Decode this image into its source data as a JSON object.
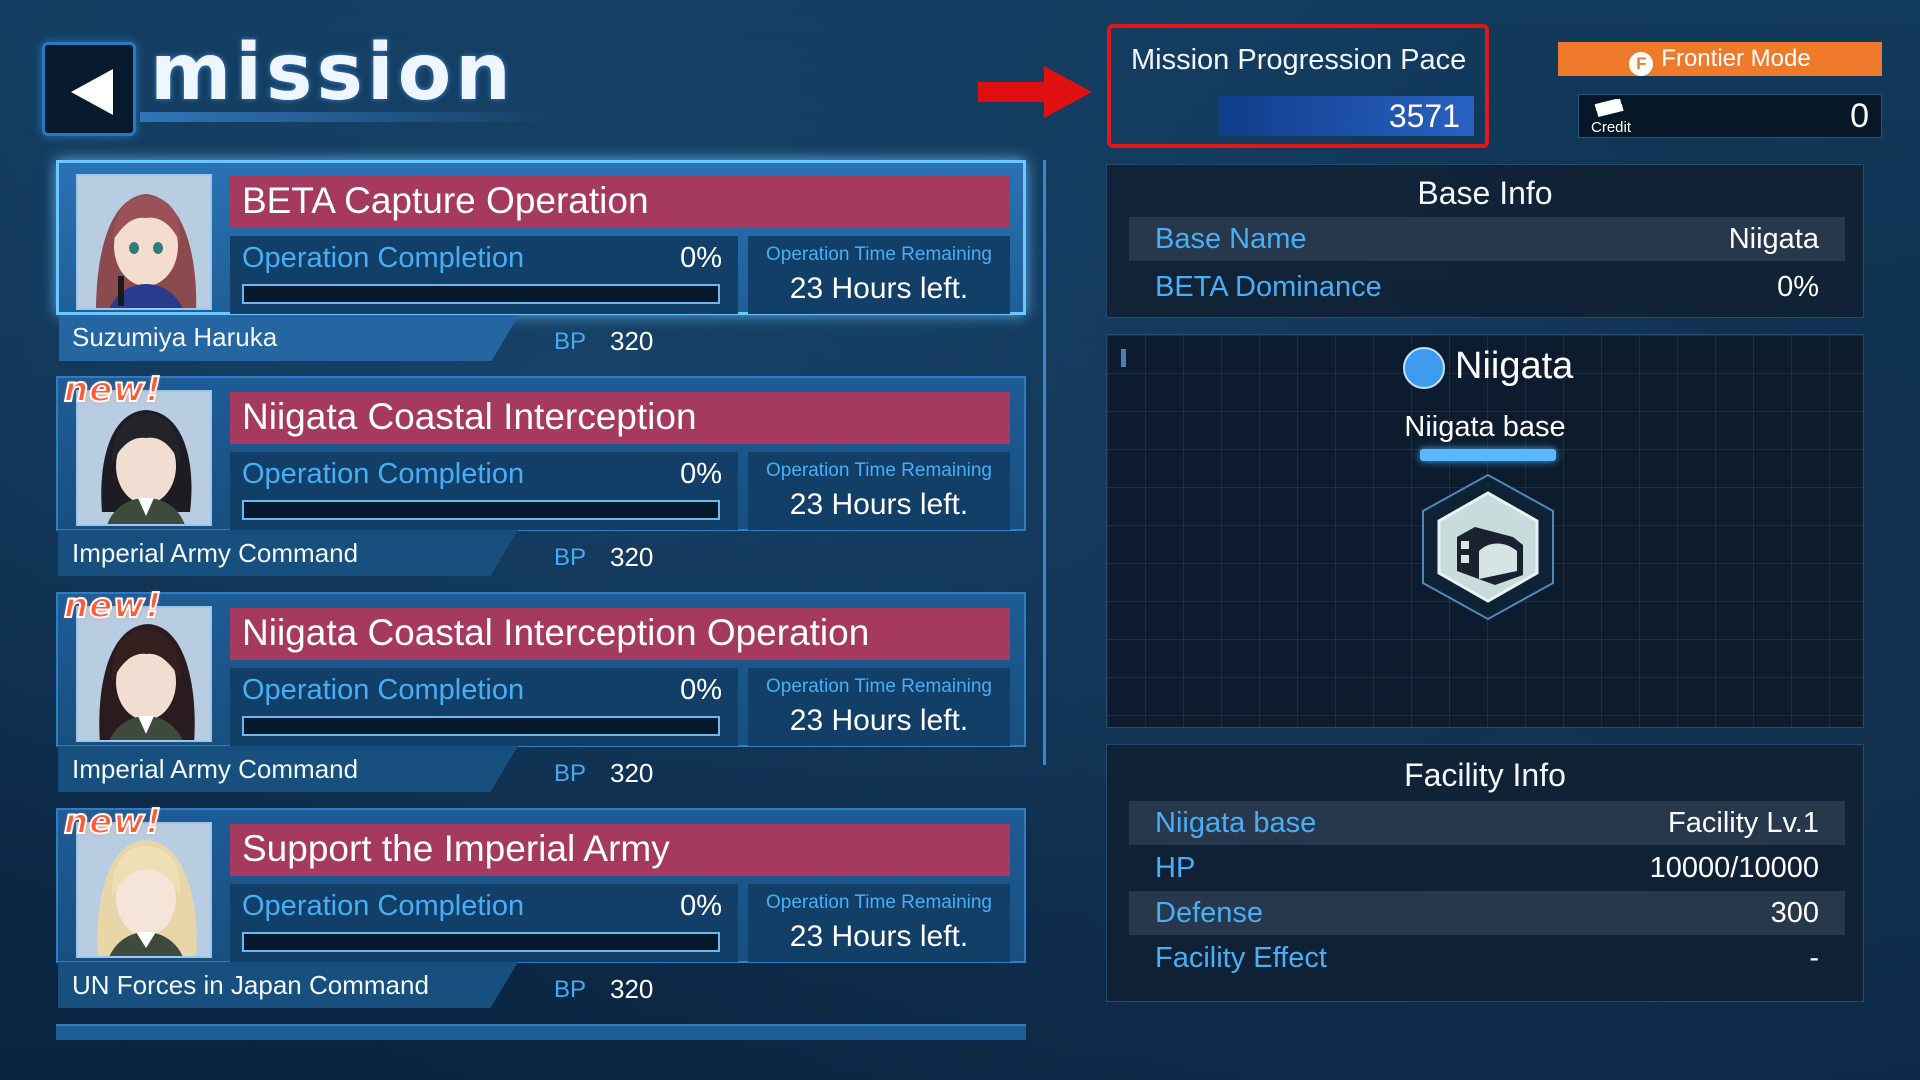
{
  "header": {
    "title": "MISSION",
    "back_label": "Back"
  },
  "pace": {
    "label": "Mission Progression Pace",
    "value": "3571"
  },
  "frontier": {
    "label": "Frontier Mode",
    "icon_glyph": "F"
  },
  "credit": {
    "label": "Credit",
    "value": "0"
  },
  "missions": [
    {
      "title": "BETA Capture Operation",
      "issuer": "Suzumiya Haruka",
      "completion_label": "Operation Completion",
      "completion_value": "0%",
      "completion_fraction": 0,
      "time_label": "Operation Time Remaining",
      "time_value": "23 Hours left.",
      "bp_label": "BP",
      "bp_value": "320",
      "is_new": false,
      "selected": true
    },
    {
      "title": "Niigata Coastal Interception",
      "issuer": "Imperial Army Command",
      "completion_label": "Operation Completion",
      "completion_value": "0%",
      "completion_fraction": 0,
      "time_label": "Operation Time Remaining",
      "time_value": "23 Hours left.",
      "bp_label": "BP",
      "bp_value": "320",
      "is_new": true,
      "new_label": "new!",
      "selected": false
    },
    {
      "title": "Niigata Coastal Interception Operation",
      "issuer": "Imperial Army Command",
      "completion_label": "Operation Completion",
      "completion_value": "0%",
      "completion_fraction": 0,
      "time_label": "Operation Time Remaining",
      "time_value": "23 Hours left.",
      "bp_label": "BP",
      "bp_value": "320",
      "is_new": true,
      "new_label": "new!",
      "selected": false
    },
    {
      "title": "Support the Imperial Army",
      "issuer": "UN Forces in Japan Command",
      "completion_label": "Operation Completion",
      "completion_value": "0%",
      "completion_fraction": 0,
      "time_label": "Operation Time Remaining",
      "time_value": "23 Hours left.",
      "bp_label": "BP",
      "bp_value": "320",
      "is_new": true,
      "new_label": "new!",
      "selected": false
    }
  ],
  "base_info": {
    "title": "Base Info",
    "rows": [
      {
        "key": "Base Name",
        "value": "Niigata"
      },
      {
        "key": "BETA Dominance",
        "value": "0%"
      }
    ]
  },
  "map": {
    "name": "Niigata",
    "base_label": "Niigata base",
    "icon": "facility-hangar-icon"
  },
  "facility_info": {
    "title": "Facility Info",
    "rows": [
      {
        "key": "Niigata base",
        "value": "Facility Lv.1"
      },
      {
        "key": "HP",
        "value": "10000/10000"
      },
      {
        "key": "Defense",
        "value": "300"
      },
      {
        "key": "Facility Effect",
        "value": "-"
      }
    ]
  },
  "colors": {
    "accent_blue": "#48aef5",
    "title_bar": "#a63a5e",
    "frontier_orange": "#f07a2c",
    "highlight_red": "#e01818",
    "new_badge": "#ff5b38"
  }
}
